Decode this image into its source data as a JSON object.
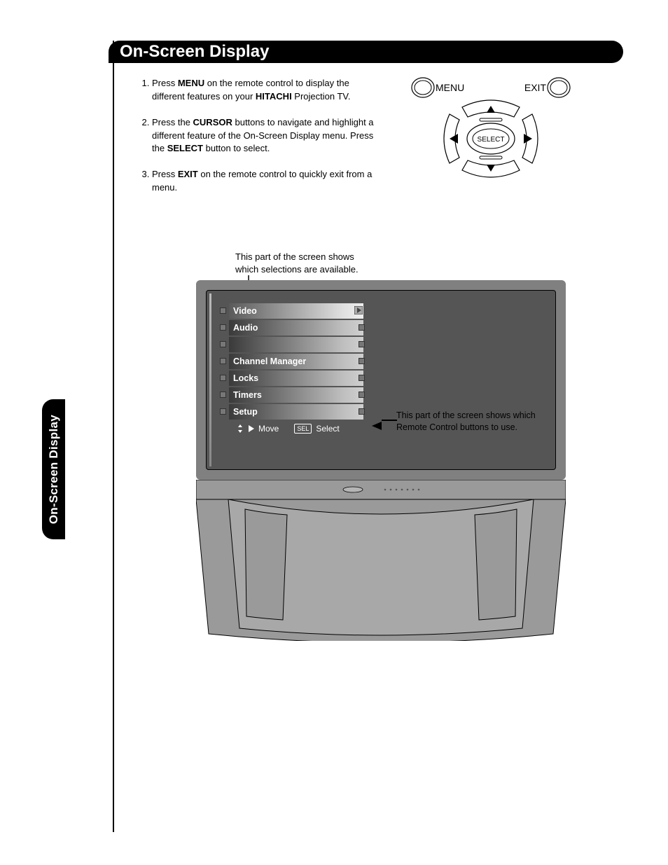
{
  "title": "On-Screen Display",
  "sideTab": "On-Screen Display",
  "instructions": {
    "i1": {
      "pre": "Press ",
      "b1": "MENU",
      "mid": " on the remote control to display the different features on your ",
      "b2": "HITACHI",
      "post": " Projection TV."
    },
    "i2": {
      "pre": "Press the ",
      "b1": "CURSOR",
      "mid": " buttons to navigate and highlight a different feature of the On-Screen Display menu. Press the ",
      "b2": "SELECT",
      "post": " button to select."
    },
    "i3": {
      "pre": "Press ",
      "b1": "EXIT",
      "post": " on the remote control to quickly exit from a menu."
    }
  },
  "remote": {
    "menu": "MENU",
    "exit": "EXIT",
    "select": "SELECT"
  },
  "callout1": {
    "l1": "This part of the screen shows",
    "l2": "which selections are available."
  },
  "osdMenu": {
    "items": [
      "Video",
      "Audio",
      "",
      "Channel Manager",
      "Locks",
      "Timers",
      "Setup"
    ],
    "hintMove": "Move",
    "hintSelKey": "SEL",
    "hintSelect": "Select"
  },
  "callout2": {
    "l1": "This part of the screen shows which",
    "l2": "Remote Control buttons to use."
  }
}
